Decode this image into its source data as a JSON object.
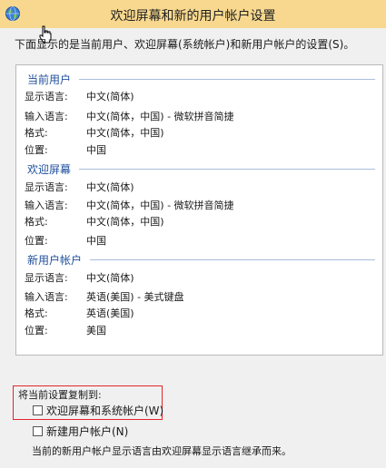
{
  "window": {
    "title": "欢迎屏幕和新的用户帐户设置",
    "icon": "globe-icon",
    "titlebar_color": "#f7d88e",
    "cursor": "hand-pointer-icon"
  },
  "intro_text": "下面显示的是当前用户、欢迎屏幕(系统帐户)和新用户帐户的设置(S)。",
  "labels": {
    "display_language": "显示语言:",
    "input_language": "输入语言:",
    "format": "格式:",
    "location": "位置:"
  },
  "sections": [
    {
      "title": "当前用户",
      "display_language": "中文(简体)",
      "input_language": "中文(简体，中国) - 微软拼音简捷",
      "format": "中文(简体，中国)",
      "location": "中国"
    },
    {
      "title": "欢迎屏幕",
      "display_language": "中文(简体)",
      "input_language": "中文(简体，中国) - 微软拼音简捷",
      "format": "中文(简体，中国)",
      "location": "中国"
    },
    {
      "title": "新用户帐户",
      "display_language": "中文(简体)",
      "input_language": "英语(美国) - 美式键盘",
      "format": "英语(美国)",
      "location": "美国"
    }
  ],
  "copy_settings": {
    "label": "将当前设置复制到:",
    "options": [
      {
        "label": "欢迎屏幕和系统帐户(W)",
        "checked": false
      },
      {
        "label": "新建用户帐户(N)",
        "checked": false
      }
    ],
    "highlight_color": "#e3262a"
  },
  "footer_note": "当前的新用户帐户显示语言由欢迎屏幕显示语言继承而来。"
}
